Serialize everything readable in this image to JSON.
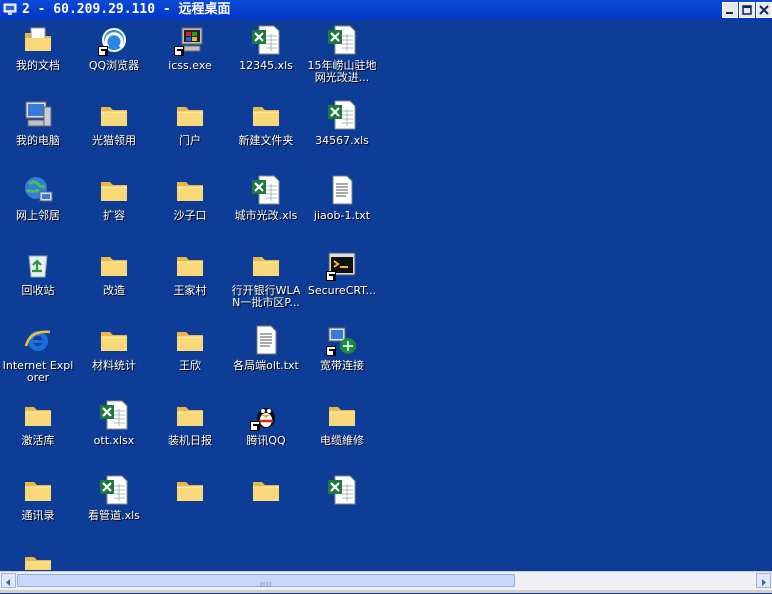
{
  "window": {
    "title": "2 - 60.209.29.110 - 远程桌面"
  },
  "desktop_icons": [
    {
      "label": "我的文档",
      "icon": "my-documents-icon"
    },
    {
      "label": "QQ浏览器",
      "icon": "qq-browser-icon"
    },
    {
      "label": "icss.exe",
      "icon": "exe-icon"
    },
    {
      "label": "12345.xls",
      "icon": "excel-file-icon"
    },
    {
      "label": "15年崂山驻地网光改进...",
      "icon": "excel-file-icon"
    },
    {
      "label": "我的电脑",
      "icon": "my-computer-icon"
    },
    {
      "label": "光猫领用",
      "icon": "folder-icon"
    },
    {
      "label": "门户",
      "icon": "folder-icon"
    },
    {
      "label": "新建文件夹",
      "icon": "folder-icon"
    },
    {
      "label": "34567.xls",
      "icon": "excel-file-icon"
    },
    {
      "label": "网上邻居",
      "icon": "network-places-icon"
    },
    {
      "label": "扩容",
      "icon": "folder-icon"
    },
    {
      "label": "沙子口",
      "icon": "folder-icon"
    },
    {
      "label": "城市光改.xls",
      "icon": "excel-file-icon"
    },
    {
      "label": "jiaob-1.txt",
      "icon": "text-file-icon"
    },
    {
      "label": "回收站",
      "icon": "recycle-bin-icon"
    },
    {
      "label": "改造",
      "icon": "folder-icon"
    },
    {
      "label": "王家村",
      "icon": "folder-icon"
    },
    {
      "label": "行开银行WLAN一批市区P...",
      "icon": "folder-icon"
    },
    {
      "label": "SecureCRT...",
      "icon": "securecrt-icon"
    },
    {
      "label": "Internet Explorer",
      "icon": "internet-explorer-icon"
    },
    {
      "label": "材料统计",
      "icon": "folder-icon"
    },
    {
      "label": "王欣",
      "icon": "folder-icon"
    },
    {
      "label": "各局端olt.txt",
      "icon": "text-file-icon"
    },
    {
      "label": "宽带连接",
      "icon": "broadband-connection-icon"
    },
    {
      "label": "激活库",
      "icon": "folder-icon"
    },
    {
      "label": "ott.xlsx",
      "icon": "excel-file-icon"
    },
    {
      "label": "装机日报",
      "icon": "folder-icon"
    },
    {
      "label": "腾讯QQ",
      "icon": "qq-icon"
    },
    {
      "label": "电缆維修",
      "icon": "folder-icon"
    },
    {
      "label": "通讯录",
      "icon": "folder-icon"
    },
    {
      "label": "看管道.xls",
      "icon": "excel-file-icon"
    },
    {
      "label": "",
      "icon": "folder-icon"
    },
    {
      "label": "",
      "icon": "folder-icon"
    },
    {
      "label": "",
      "icon": "excel-file-icon"
    },
    {
      "label": "",
      "icon": "folder-icon"
    }
  ]
}
